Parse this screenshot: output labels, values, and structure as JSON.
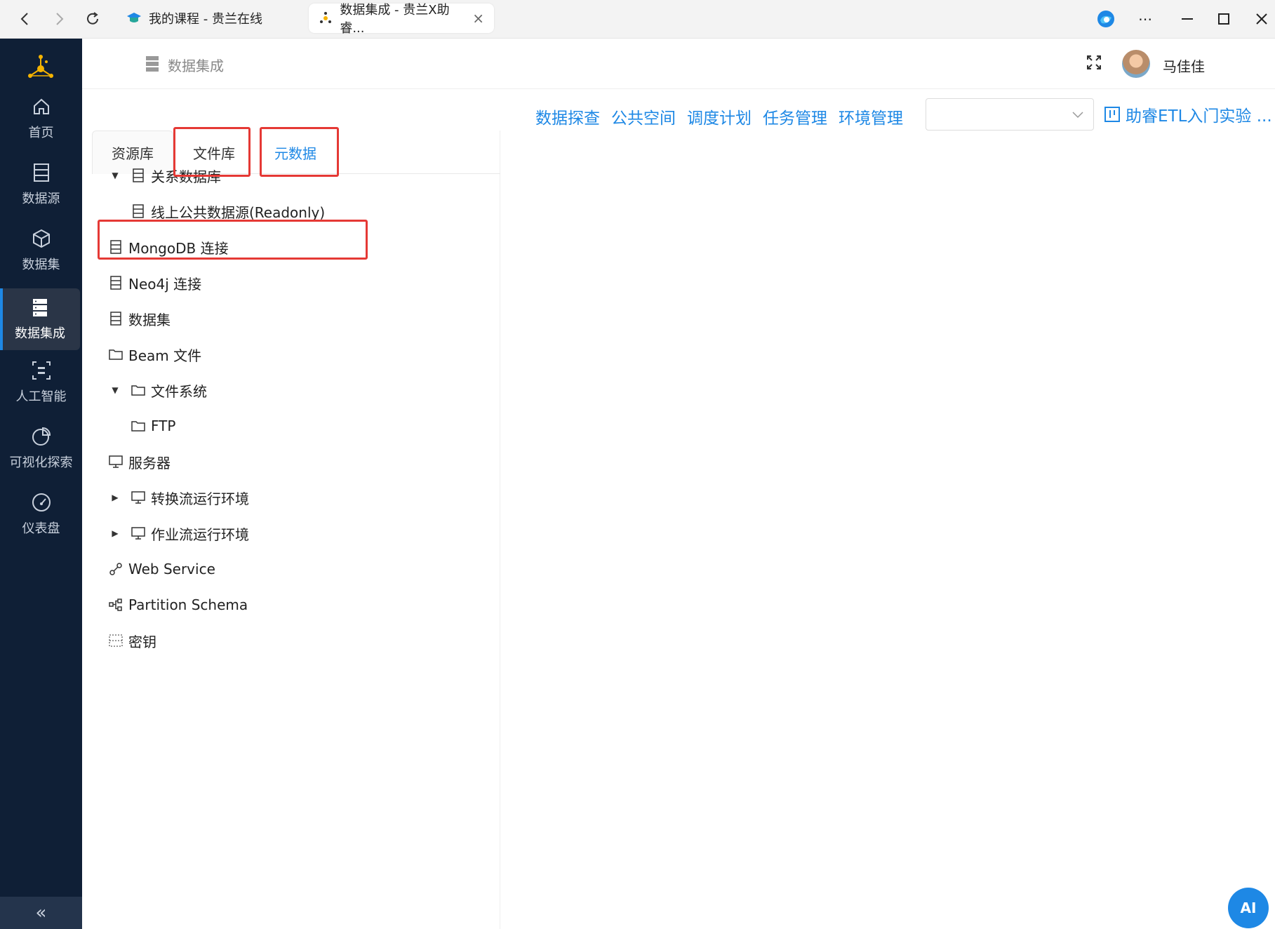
{
  "browser": {
    "tabs": [
      {
        "label": "我的课程 - 贵兰在线"
      },
      {
        "label": "数据集成 - 贵兰X助睿..."
      }
    ]
  },
  "sidebar": {
    "items": [
      {
        "label": "首页",
        "icon": "home-icon"
      },
      {
        "label": "数据源",
        "icon": "database-icon"
      },
      {
        "label": "数据集",
        "icon": "cube-icon"
      },
      {
        "label": "数据集成",
        "icon": "server-icon"
      },
      {
        "label": "人工智能",
        "icon": "ai-icon"
      },
      {
        "label": "可视化探索",
        "icon": "pie-chart-icon"
      },
      {
        "label": "仪表盘",
        "icon": "gauge-icon"
      }
    ],
    "collapse": "«"
  },
  "header": {
    "title": "数据集成",
    "user": "马佳佳"
  },
  "toolbar": {
    "links": [
      "数据探查",
      "公共空间",
      "调度计划",
      "任务管理",
      "环境管理"
    ],
    "select_value": "",
    "project": "助睿ETL入门实验 ..."
  },
  "panel": {
    "tabs": [
      "资源库",
      "文件库",
      "元数据"
    ],
    "tree": [
      {
        "label": "关系数据库"
      },
      {
        "label": "线上公共数据源(Readonly)"
      },
      {
        "label": "MongoDB 连接"
      },
      {
        "label": "Neo4j 连接"
      },
      {
        "label": "数据集"
      },
      {
        "label": "Beam 文件"
      },
      {
        "label": "文件系统"
      },
      {
        "label": "FTP"
      },
      {
        "label": "服务器"
      },
      {
        "label": "转换流运行环境"
      },
      {
        "label": "作业流运行环境"
      },
      {
        "label": "Web Service"
      },
      {
        "label": "Partition Schema"
      },
      {
        "label": "密钥"
      }
    ]
  },
  "ai_button": "AI",
  "colors": {
    "accent": "#1e88e5",
    "sidebar_bg": "#0f1f36",
    "highlight": "#e53935"
  }
}
